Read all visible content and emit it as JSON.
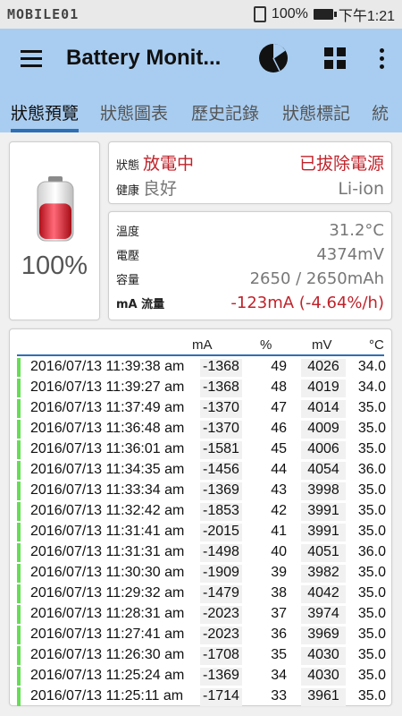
{
  "status_bar": {
    "logo": "MOBILE01",
    "battery": "100%",
    "time": "下午1:21"
  },
  "app_bar": {
    "title": "Battery Monit..."
  },
  "tabs": [
    {
      "label": "狀態預覽",
      "active": true
    },
    {
      "label": "狀態圖表",
      "active": false
    },
    {
      "label": "歷史記錄",
      "active": false
    },
    {
      "label": "狀態標記",
      "active": false
    },
    {
      "label": "統",
      "active": false
    }
  ],
  "battery": {
    "level": "100%",
    "fill_fraction": 0.62
  },
  "status": {
    "status_label": "狀態",
    "status_value": "放電中",
    "power_value": "已拔除電源",
    "health_label": "健康",
    "health_value": "良好",
    "tech_value": "Li-ion"
  },
  "info": {
    "temp_label": "溫度",
    "temp_value": "31.2°C",
    "voltage_label": "電壓",
    "voltage_value": "4374mV",
    "capacity_label": "容量",
    "capacity_value": "2650 / 2650mAh",
    "current_label": "mA 流量",
    "current_value": "-123mA (-4.64%/h)"
  },
  "table": {
    "headers": {
      "ma": "mA",
      "pct": "%",
      "mv": "mV",
      "c": "°C"
    },
    "rows": [
      {
        "time": "2016/07/13  11:39:38 am",
        "ma": "-1368",
        "pct": "49",
        "mv": "4026",
        "c": "34.0"
      },
      {
        "time": "2016/07/13  11:39:27 am",
        "ma": "-1368",
        "pct": "48",
        "mv": "4019",
        "c": "34.0"
      },
      {
        "time": "2016/07/13  11:37:49 am",
        "ma": "-1370",
        "pct": "47",
        "mv": "4014",
        "c": "35.0"
      },
      {
        "time": "2016/07/13  11:36:48 am",
        "ma": "-1370",
        "pct": "46",
        "mv": "4009",
        "c": "35.0"
      },
      {
        "time": "2016/07/13  11:36:01 am",
        "ma": "-1581",
        "pct": "45",
        "mv": "4006",
        "c": "35.0"
      },
      {
        "time": "2016/07/13  11:34:35 am",
        "ma": "-1456",
        "pct": "44",
        "mv": "4054",
        "c": "36.0"
      },
      {
        "time": "2016/07/13  11:33:34 am",
        "ma": "-1369",
        "pct": "43",
        "mv": "3998",
        "c": "35.0"
      },
      {
        "time": "2016/07/13  11:32:42 am",
        "ma": "-1853",
        "pct": "42",
        "mv": "3991",
        "c": "35.0"
      },
      {
        "time": "2016/07/13  11:31:41 am",
        "ma": "-2015",
        "pct": "41",
        "mv": "3991",
        "c": "35.0"
      },
      {
        "time": "2016/07/13  11:31:31 am",
        "ma": "-1498",
        "pct": "40",
        "mv": "4051",
        "c": "36.0"
      },
      {
        "time": "2016/07/13  11:30:30 am",
        "ma": "-1909",
        "pct": "39",
        "mv": "3982",
        "c": "35.0"
      },
      {
        "time": "2016/07/13  11:29:32 am",
        "ma": "-1479",
        "pct": "38",
        "mv": "4042",
        "c": "35.0"
      },
      {
        "time": "2016/07/13  11:28:31 am",
        "ma": "-2023",
        "pct": "37",
        "mv": "3974",
        "c": "35.0"
      },
      {
        "time": "2016/07/13  11:27:41 am",
        "ma": "-2023",
        "pct": "36",
        "mv": "3969",
        "c": "35.0"
      },
      {
        "time": "2016/07/13  11:26:30 am",
        "ma": "-1708",
        "pct": "35",
        "mv": "4030",
        "c": "35.0"
      },
      {
        "time": "2016/07/13  11:25:24 am",
        "ma": "-1369",
        "pct": "34",
        "mv": "4030",
        "c": "35.0"
      },
      {
        "time": "2016/07/13  11:25:11 am",
        "ma": "-1714",
        "pct": "33",
        "mv": "3961",
        "c": "35.0"
      }
    ]
  },
  "colors": {
    "appbar": "#a9cdf0",
    "tab_indicator": "#2f6fb5",
    "discharge_red": "#c0232b",
    "row_marker": "#66dd55"
  }
}
